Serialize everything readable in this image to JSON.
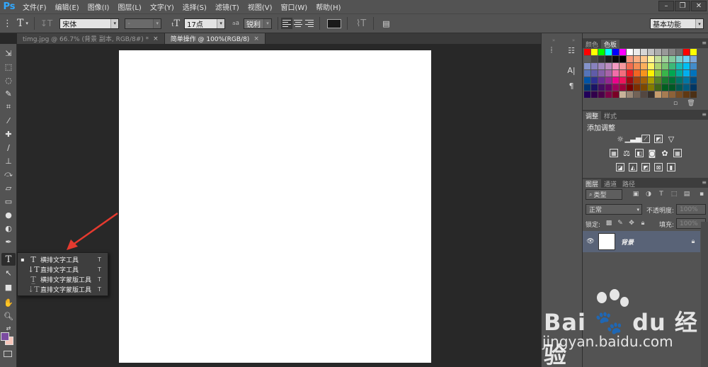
{
  "app": {
    "logo": "Ps"
  },
  "menu": [
    "文件(F)",
    "编辑(E)",
    "图像(I)",
    "图层(L)",
    "文字(Y)",
    "选择(S)",
    "滤镜(T)",
    "视图(V)",
    "窗口(W)",
    "帮助(H)"
  ],
  "options": {
    "font_family": "宋体",
    "font_style": "-",
    "font_size": "17点",
    "antialias_prefix": "a",
    "antialias": "锐利",
    "text_color": "#1a1a1a",
    "workspace": "基本功能"
  },
  "tabs": [
    {
      "label": "timg.jpg @ 66.7% (背景 副本, RGB/8#) *",
      "close": "×"
    },
    {
      "label": "简单操作 @ 100%(RGB/8)",
      "close": "×"
    }
  ],
  "flyout": {
    "items": [
      {
        "label": "横排文字工具",
        "key": "T",
        "selected": "▪"
      },
      {
        "label": "直排文字工具",
        "key": "T",
        "selected": ""
      },
      {
        "label": "横排文字蒙版工具",
        "key": "T",
        "selected": ""
      },
      {
        "label": "直排文字蒙版工具",
        "key": "T",
        "selected": ""
      }
    ]
  },
  "colors": {
    "foreground": "#7b4ba0",
    "background": "#f7c7bb",
    "accent_arrow": "#e53a2f",
    "layer_selected": "#596377"
  },
  "panels": {
    "swatches_tabs": [
      "颜色",
      "色板"
    ],
    "adjust_tabs": [
      "调整",
      "样式"
    ],
    "adjust_title": "添加调整",
    "layers_tabs": [
      "图层",
      "通道",
      "路径"
    ],
    "layers_filter": "类型",
    "blend_mode": "正常",
    "opacity_label": "不透明度:",
    "opacity_value": "100%",
    "lock_label": "锁定:",
    "fill_label": "填充:",
    "fill_value": "100%",
    "layer_name": "背景"
  },
  "swatches": [
    "#ff0000",
    "#ffff00",
    "#00ff00",
    "#00ffff",
    "#0000ff",
    "#ff00ff",
    "#ffffff",
    "#ebebeb",
    "#d6d6d6",
    "#c2c2c2",
    "#adadad",
    "#999999",
    "#858585",
    "#707070",
    "#ff0000",
    "#ffff00",
    "#5c5c5c",
    "#474747",
    "#333333",
    "#1f1f1f",
    "#0a0a0a",
    "#000000",
    "#f7977a",
    "#f9ad81",
    "#fdc68a",
    "#fff79a",
    "#c4df9b",
    "#a2d39c",
    "#82ca9d",
    "#7bcdc8",
    "#6ecff6",
    "#7ea7d8",
    "#8493ca",
    "#8882be",
    "#a187be",
    "#bc8dbf",
    "#f49ac2",
    "#f6989d",
    "#f26c4f",
    "#f68e55",
    "#fbaf5c",
    "#fff467",
    "#acd372",
    "#7cc576",
    "#3bb878",
    "#1abbb4",
    "#00bff3",
    "#438cca",
    "#5574b9",
    "#605ca8",
    "#855fa8",
    "#a763a8",
    "#f06ea9",
    "#f26d7d",
    "#ed1c24",
    "#f26522",
    "#f7941d",
    "#fff200",
    "#8dc73f",
    "#39b54a",
    "#00a651",
    "#00a99d",
    "#00aeef",
    "#0072bc",
    "#0054a6",
    "#2e3192",
    "#662d91",
    "#92278f",
    "#ec008c",
    "#ed145b",
    "#9e0b0f",
    "#a0410d",
    "#a36209",
    "#aba000",
    "#598527",
    "#197b30",
    "#007236",
    "#00746b",
    "#0076a3",
    "#004b80",
    "#003471",
    "#1b1464",
    "#440e62",
    "#630460",
    "#9e005d",
    "#9e0039",
    "#790000",
    "#7b2e00",
    "#7d4900",
    "#827b00",
    "#406618",
    "#005e20",
    "#005826",
    "#005952",
    "#005b7f",
    "#003663",
    "#21005a",
    "#32004b",
    "#4b0049",
    "#7b0046",
    "#7a0026",
    "#c7b299",
    "#998675",
    "#736357",
    "#534741",
    "#37302d",
    "#c69c6d",
    "#a67c52",
    "#8c6239",
    "#754c24",
    "#603913",
    "#4b3016"
  ]
}
